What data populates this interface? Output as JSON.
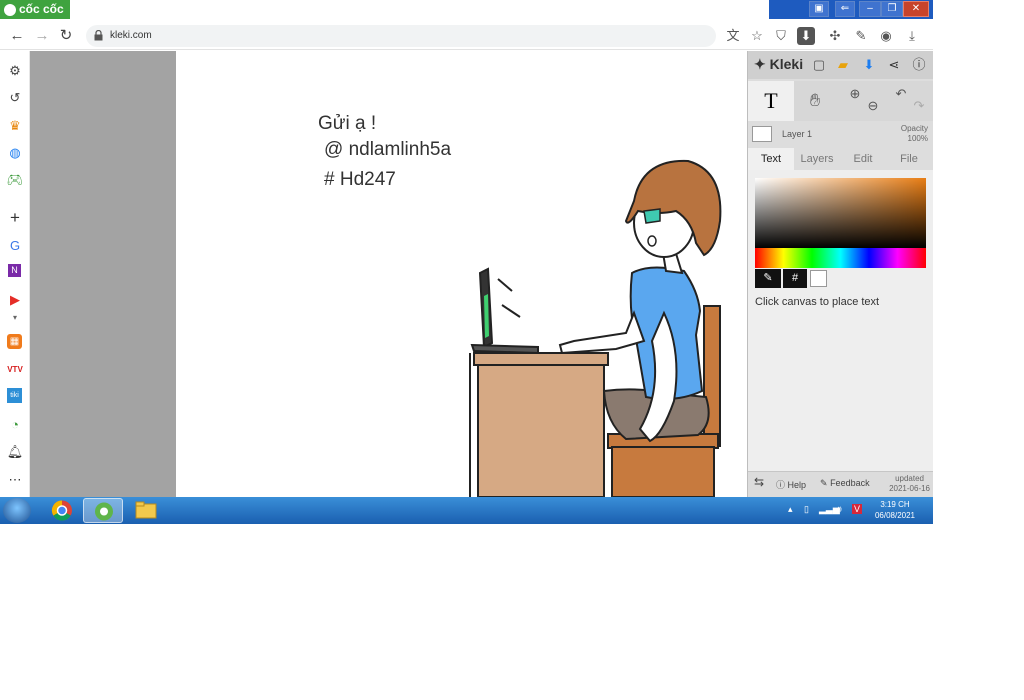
{
  "browser": {
    "name": "cốc cốc",
    "url": "kleki.com"
  },
  "canvas": {
    "lines": [
      "Gửi ạ !",
      "@ ndlamlinh5a",
      "# Hd247"
    ]
  },
  "panel": {
    "logo": "Kleki",
    "tool_text": "T",
    "layer_name": "Layer 1",
    "opacity_label": "Opacity",
    "opacity_value": "100%",
    "tabs": [
      "Text",
      "Layers",
      "Edit",
      "File"
    ],
    "active_tab": "Text",
    "hex_label": "#",
    "hint": "Click canvas to place text",
    "help": "Help",
    "feedback": "Feedback",
    "updated_label": "updated",
    "updated_date": "2021-06-16"
  },
  "taskbar": {
    "time": "3:19 CH",
    "date": "06/08/2021"
  },
  "colors": {
    "chrome_green": "#3fa33f",
    "taskbar_blue": "#1a5fb0",
    "shirt_blue": "#5aa7ef",
    "desk_tan": "#d6a984",
    "chair_brown": "#c77a3e",
    "hair_brown": "#b8733f"
  }
}
